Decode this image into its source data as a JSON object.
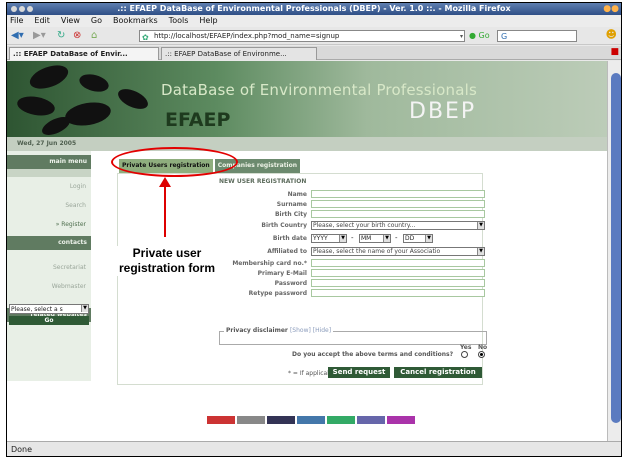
{
  "window": {
    "title": ".:: EFAEP DataBase of Environmental Professionals (DBEP) - Ver. 1.0 ::. - Mozilla Firefox"
  },
  "menu": [
    "File",
    "Edit",
    "View",
    "Go",
    "Bookmarks",
    "Tools",
    "Help"
  ],
  "nav": {
    "url": "http://localhost/EFAEP/index.php?mod_name=signup",
    "go_label": "Go"
  },
  "tabs": [
    {
      "label": ".:: EFAEP DataBase of Envir..."
    },
    {
      "label": ".:: EFAEP DataBase of Environme..."
    }
  ],
  "banner": {
    "title": "DataBase of Environmental Professionals",
    "logo": "EFAEP",
    "dbep": "DBEP"
  },
  "date": "Wed, 27 Jun 2005",
  "sidebar": {
    "main_menu": "main menu",
    "items": [
      "Login",
      "Search",
      "» Register"
    ],
    "contacts": "contacts",
    "contact_items": [
      "Secretariat",
      "Webmaster"
    ],
    "related": "related websites",
    "select_value": "Please, select a s",
    "go": "Go"
  },
  "page_tabs": [
    "Private Users registration",
    "Companies registration"
  ],
  "form": {
    "title": "NEW USER REGISTRATION",
    "fields": {
      "name": "Name",
      "surname": "Surname",
      "birth_city": "Birth City",
      "birth_country": "Birth Country",
      "birth_date": "Birth date",
      "affiliated": "Affiliated to",
      "membership": "Membership card no.*",
      "email": "Primary E-Mail",
      "password": "Password",
      "retype": "Retype password"
    },
    "birth_country_placeholder": "Please, select your birth country...",
    "date_yyyy": "YYYY",
    "date_mm": "MM",
    "date_dd": "DD",
    "affiliated_placeholder": "Please, select the name of your Associatio",
    "privacy_legend": "Privacy disclaimer",
    "privacy_links": "[Show] [Hide]",
    "agree_question": "Do you accept the above terms and conditions?",
    "yes": "Yes",
    "no": "No",
    "applicable": "* = If applicable",
    "send": "Send request",
    "cancel": "Cancel registration"
  },
  "annotation": {
    "text": "Private user registration form"
  },
  "status": "Done"
}
